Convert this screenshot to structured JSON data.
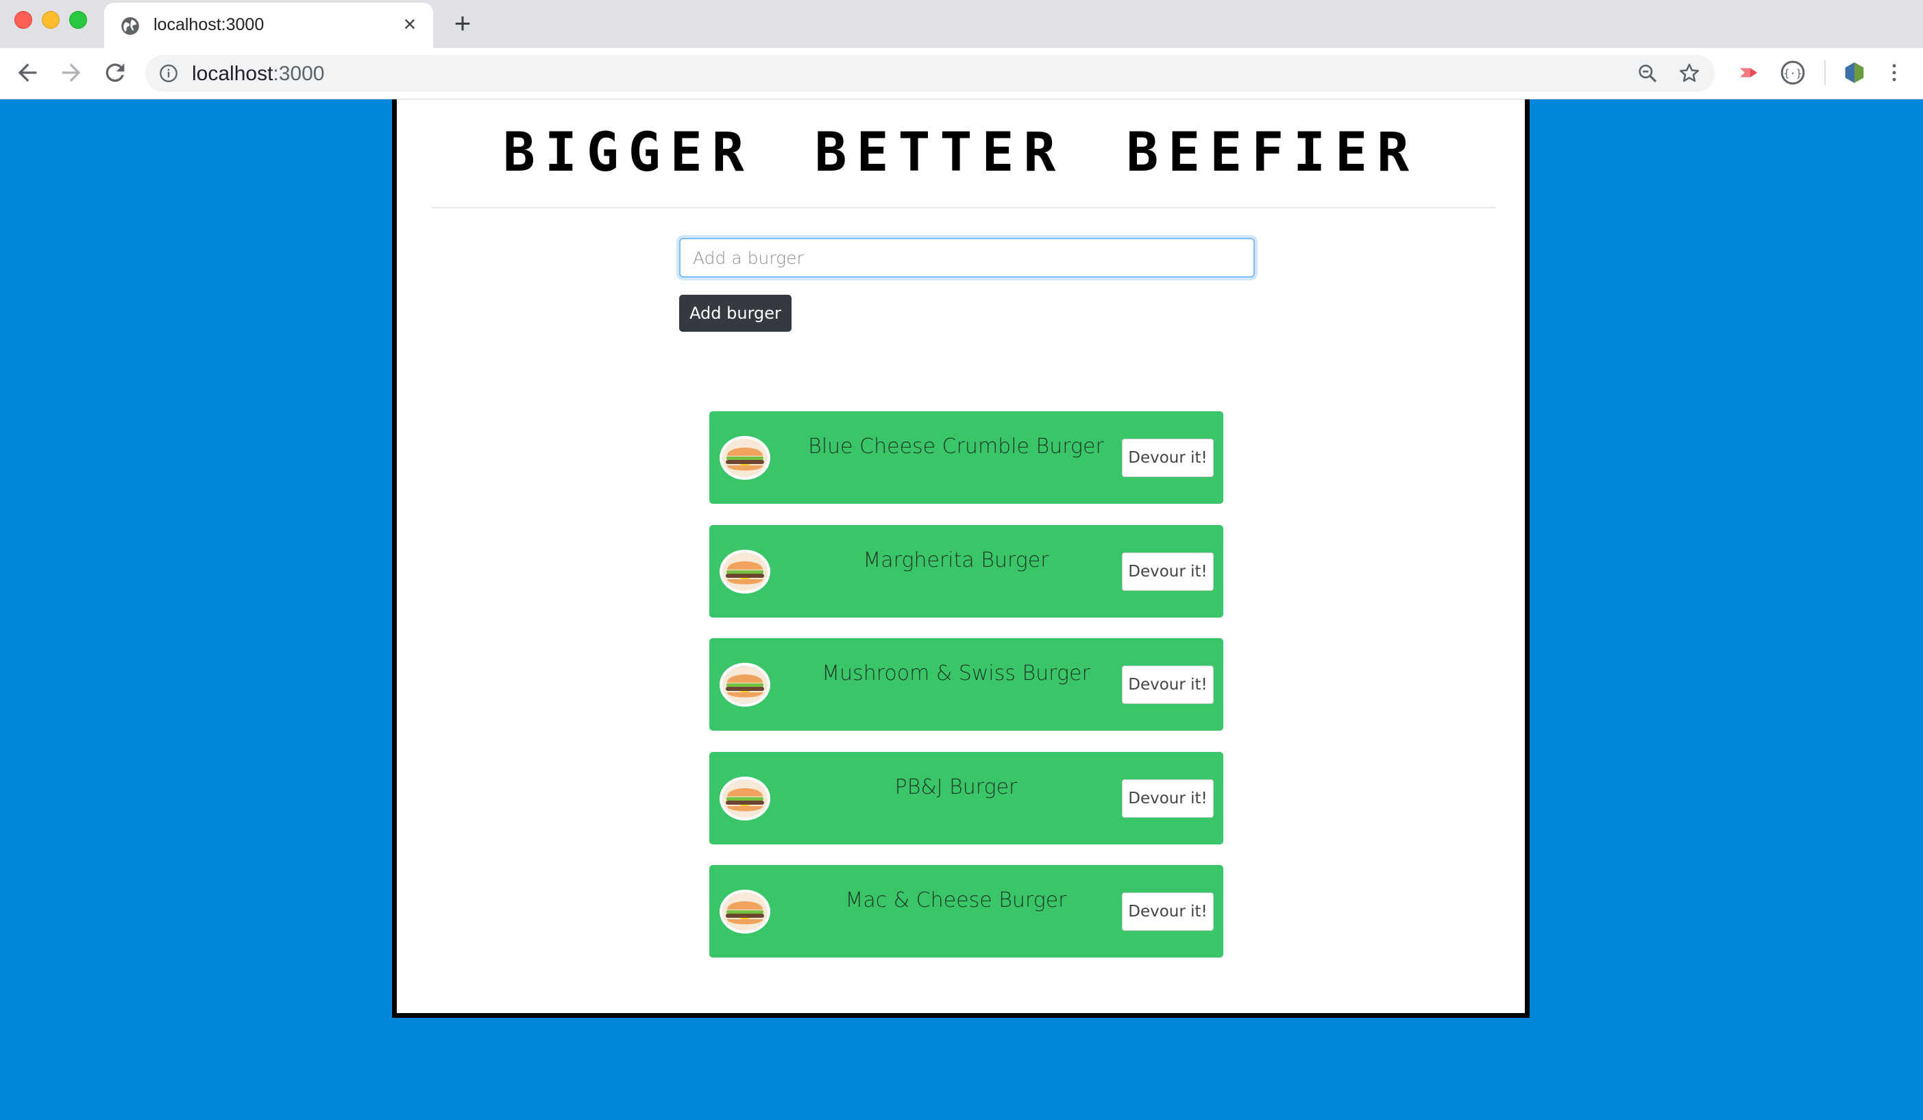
{
  "browser": {
    "tab_title": "localhost:3000",
    "url_host": "localhost",
    "url_port": ":3000"
  },
  "page": {
    "title": "BIGGER BETTER BEEFIER",
    "input_placeholder": "Add a burger",
    "add_button_label": "Add burger",
    "devour_label": "Devour it!",
    "burgers": [
      {
        "name": "Blue Cheese Crumble Burger"
      },
      {
        "name": "Margherita Burger"
      },
      {
        "name": "Mushroom & Swiss Burger"
      },
      {
        "name": "PB&J Burger"
      },
      {
        "name": "Mac & Cheese Burger"
      }
    ]
  },
  "colors": {
    "background": "#0288da",
    "card": "#3ac569",
    "dark_button": "#343a40"
  },
  "icons": [
    "globe-icon",
    "close-icon",
    "plus-icon",
    "back-icon",
    "forward-icon",
    "reload-icon",
    "info-icon",
    "zoom-icon",
    "star-icon",
    "burger-icon"
  ]
}
